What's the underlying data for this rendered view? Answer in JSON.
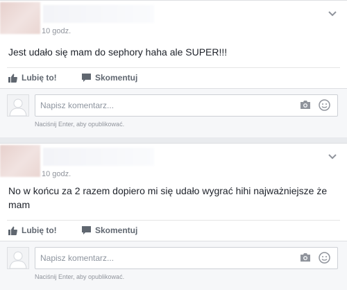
{
  "posts": [
    {
      "time": "10 godz.",
      "text": "Jest udało się mam do sephory haha ale SUPER!!!",
      "like_label": "Lubię to!",
      "comment_label": "Skomentuj",
      "comment_placeholder": "Napisz komentarz...",
      "hint": "Naciśnij Enter, aby opublikować."
    },
    {
      "time": "10 godz.",
      "text": "No w końcu za 2 razem dopiero mi się udało wygrać hihi najważniejsze że mam",
      "like_label": "Lubię to!",
      "comment_label": "Skomentuj",
      "comment_placeholder": "Napisz komentarz...",
      "hint": "Naciśnij Enter, aby opublikować."
    }
  ],
  "icons": {
    "chevron": "chevron-down-icon",
    "like": "thumbs-up-icon",
    "comment": "speech-bubble-icon",
    "camera": "camera-icon",
    "emoji": "smiley-icon",
    "avatar": "default-avatar-icon"
  },
  "colors": {
    "background": "#e9ebee",
    "card": "#ffffff",
    "action_text": "#606770",
    "muted": "#90949c"
  }
}
